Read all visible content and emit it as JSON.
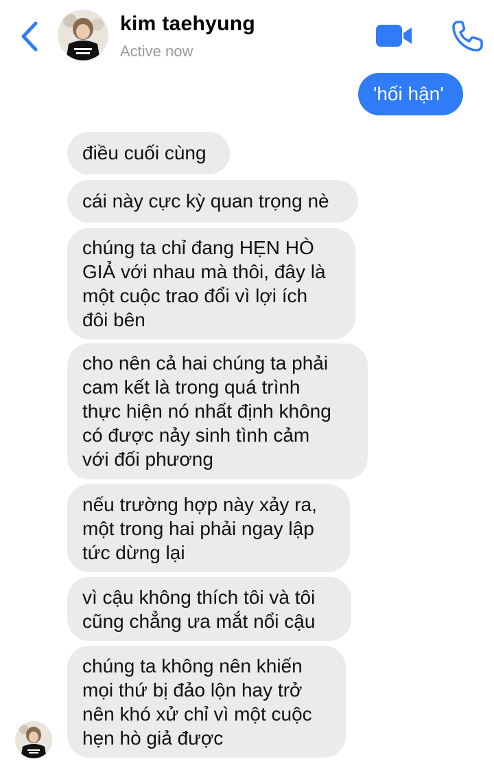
{
  "header": {
    "contact_name": "kim taehyung",
    "status": "Active now",
    "back_icon": "chevron-left-icon",
    "video_icon": "video-camera-icon",
    "call_icon": "phone-icon",
    "accent_color": "#2f7cf6"
  },
  "messages": {
    "sent": [
      {
        "lines": [
          "'hối hận'"
        ]
      }
    ],
    "received": [
      {
        "lines": [
          "điều cuối cùng"
        ]
      },
      {
        "lines": [
          "cái này cực kỳ quan trọng nè"
        ]
      },
      {
        "lines": [
          "chúng ta chỉ đang HẸN HÒ",
          "GIẢ với nhau mà thôi, đây là",
          "một cuộc trao đổi vì lợi ích",
          "đôi bên"
        ]
      },
      {
        "lines": [
          "cho nên cả hai chúng ta phải",
          "cam kết là trong quá trình",
          "thực hiện nó nhất định không",
          "có được nảy sinh tình cảm",
          "với đối phương"
        ]
      },
      {
        "lines": [
          "nếu trường hợp này xảy ra,",
          "một trong hai phải ngay lập",
          "tức dừng lại"
        ]
      },
      {
        "lines": [
          "vì cậu không thích tôi và tôi",
          "cũng chẳng ưa mắt nổi cậu"
        ]
      },
      {
        "lines": [
          "chúng ta không nên khiến",
          "mọi thứ bị đảo lộn hay trở",
          "nên khó xử chỉ vì một cuộc",
          "hẹn hò giả được"
        ]
      }
    ]
  },
  "colors": {
    "sent_bubble": "#2f7cf6",
    "received_bubble": "#ebebeb",
    "status_text": "#9a9a9a"
  }
}
